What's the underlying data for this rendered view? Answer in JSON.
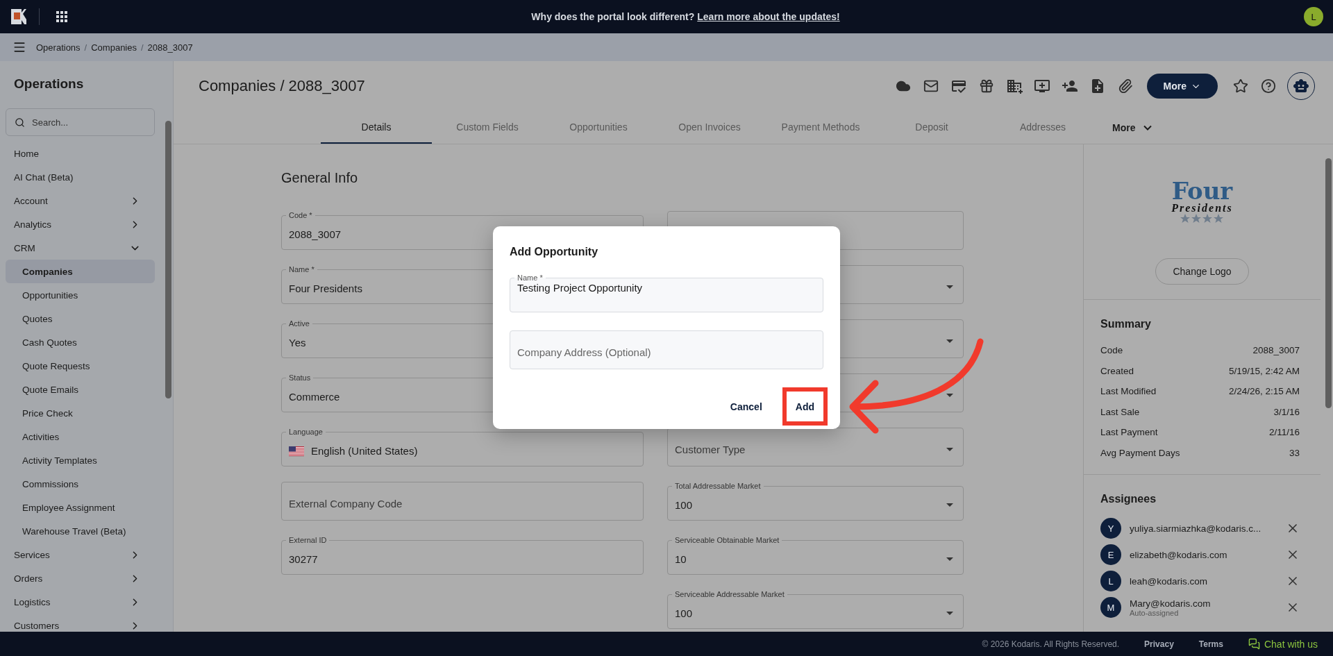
{
  "top_bar": {
    "announcement": "Why does the portal look different?",
    "announcement_link": "Learn more about the updates!",
    "avatar": "L"
  },
  "breadcrumb": {
    "separator": "/",
    "items": [
      "Operations",
      "Companies",
      "2088_3007"
    ]
  },
  "sidebar": {
    "title": "Operations",
    "search": {
      "placeholder": "Search..."
    },
    "items": [
      {
        "label": "Home",
        "kind": "link"
      },
      {
        "label": "AI Chat (Beta)",
        "kind": "link"
      },
      {
        "label": "Account",
        "kind": "group",
        "expanded": false
      },
      {
        "label": "Analytics",
        "kind": "group",
        "expanded": false
      },
      {
        "label": "CRM",
        "kind": "group",
        "expanded": true,
        "children": [
          {
            "label": "Companies",
            "selected": true
          },
          {
            "label": "Opportunities",
            "selected": false
          },
          {
            "label": "Quotes",
            "selected": false
          },
          {
            "label": "Cash Quotes",
            "selected": false
          },
          {
            "label": "Quote Requests",
            "selected": false
          },
          {
            "label": "Quote Emails",
            "selected": false
          },
          {
            "label": "Price Check",
            "selected": false
          },
          {
            "label": "Activities",
            "selected": false
          },
          {
            "label": "Activity Templates",
            "selected": false
          },
          {
            "label": "Commissions",
            "selected": false
          },
          {
            "label": "Employee Assignment",
            "selected": false
          },
          {
            "label": "Warehouse Travel (Beta)",
            "selected": false
          }
        ]
      },
      {
        "label": "Services",
        "kind": "group",
        "expanded": false
      },
      {
        "label": "Orders",
        "kind": "group",
        "expanded": false
      },
      {
        "label": "Logistics",
        "kind": "group",
        "expanded": false
      },
      {
        "label": "Customers",
        "kind": "group",
        "expanded": false
      }
    ]
  },
  "page": {
    "title": "Companies / 2088_3007",
    "more_button": "More"
  },
  "tabs": [
    {
      "label": "Details",
      "selected": true
    },
    {
      "label": "Custom Fields",
      "selected": false
    },
    {
      "label": "Opportunities",
      "selected": false
    },
    {
      "label": "Open Invoices",
      "selected": false
    },
    {
      "label": "Payment Methods",
      "selected": false
    },
    {
      "label": "Deposit",
      "selected": false
    },
    {
      "label": "Addresses",
      "selected": false
    }
  ],
  "tabs_more": "More",
  "form": {
    "title": "General Info",
    "rows": [
      {
        "left": {
          "kind": "text",
          "label": "Code *",
          "value": "2088_3007"
        },
        "right": {
          "kind": "text"
        }
      },
      {
        "left": {
          "kind": "text",
          "label": "Name *",
          "value": "Four Presidents"
        },
        "right": {
          "kind": "select"
        }
      },
      {
        "left": {
          "kind": "text",
          "label": "Active",
          "value": "Yes"
        },
        "right": {
          "kind": "select"
        }
      },
      {
        "left": {
          "kind": "text",
          "label": "Status",
          "value": "Commerce"
        },
        "right": {
          "kind": "select"
        }
      },
      {
        "left": {
          "kind": "language",
          "label": "Language",
          "value": "English (United States)"
        },
        "right": {
          "kind": "select",
          "placeholder": "Customer Type"
        }
      },
      {
        "left": {
          "kind": "text",
          "placeholder": "External Company Code"
        },
        "right": {
          "kind": "select",
          "label": "Total Addressable Market",
          "value": "100"
        }
      },
      {
        "left": {
          "kind": "text",
          "label": "External ID",
          "value": "30277"
        },
        "right": {
          "kind": "select",
          "label": "Serviceable Obtainable Market",
          "value": "10"
        }
      },
      {
        "right": {
          "kind": "select",
          "label": "Serviceable Addressable Market",
          "value": "100"
        }
      }
    ]
  },
  "side_panel": {
    "logo": {
      "line_1": "Four",
      "line_2": "Presidents"
    },
    "change_logo_button": "Change Logo",
    "summary": {
      "title": "Summary",
      "rows": [
        {
          "label": "Code",
          "value": "2088_3007"
        },
        {
          "label": "Created",
          "value": "5/19/15, 2:42 AM"
        },
        {
          "label": "Last Modified",
          "value": "2/24/26, 2:15 AM"
        },
        {
          "label": "Last Sale",
          "value": "3/1/16"
        },
        {
          "label": "Last Payment",
          "value": "2/11/16"
        },
        {
          "label": "Avg Payment Days",
          "value": "33"
        }
      ]
    },
    "assignees": {
      "title": "Assignees",
      "items": [
        {
          "initial": "Y",
          "email": "yuliya.siarmiazhka@kodaris.c..."
        },
        {
          "initial": "E",
          "email": "elizabeth@kodaris.com"
        },
        {
          "initial": "L",
          "email": "leah@kodaris.com"
        },
        {
          "initial": "M",
          "email": "Mary@kodaris.com",
          "note": "Auto-assigned"
        }
      ]
    }
  },
  "dialog": {
    "title": "Add Opportunity",
    "fields": [
      {
        "label": "Name *",
        "value": "Testing Project Opportunity"
      },
      {
        "placeholder": "Company Address (Optional)"
      }
    ],
    "buttons": [
      {
        "label": "Cancel",
        "highlighted": false
      },
      {
        "label": "Add",
        "highlighted": true
      }
    ]
  },
  "footer": {
    "copyright": "© 2026 Kodaris. All Rights Reserved.",
    "links": [
      "Privacy",
      "Terms"
    ],
    "chat": "Chat with us"
  }
}
